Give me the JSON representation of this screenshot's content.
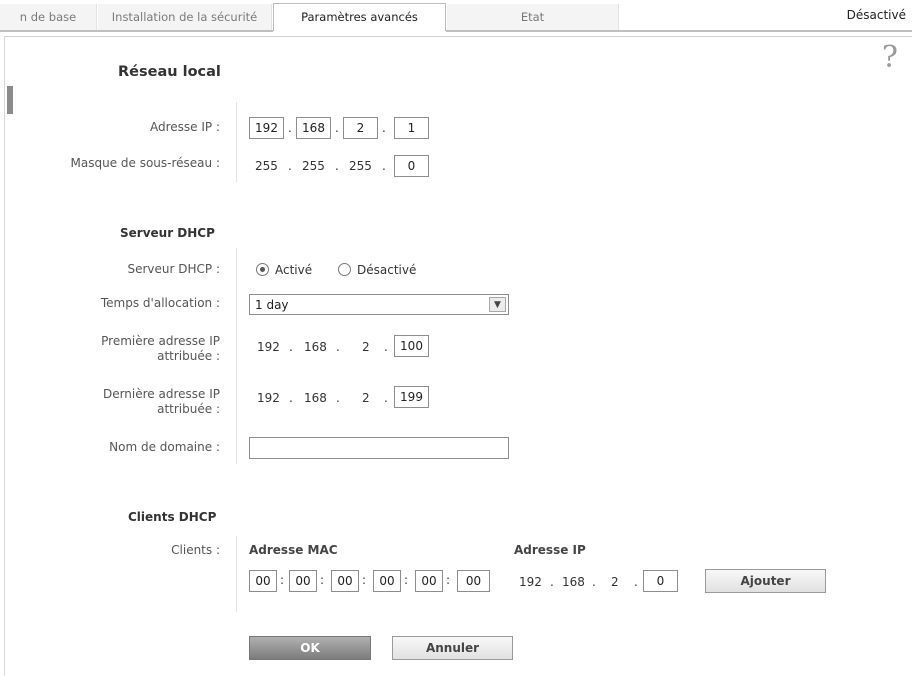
{
  "tabs": [
    {
      "label": "n de base"
    },
    {
      "label": "Installation de la sécurité"
    },
    {
      "label": "Paramètres avancés"
    },
    {
      "label": "Etat"
    }
  ],
  "status_text": "Désactivé",
  "help_glyph": "?",
  "lan": {
    "title": "Réseau local",
    "ip_label": "Adresse IP :",
    "ip": [
      "192",
      "168",
      "2",
      "1"
    ],
    "mask_label": "Masque de sous-réseau :",
    "mask": [
      "255",
      "255",
      "255",
      "0"
    ]
  },
  "dhcp": {
    "title": "Serveur DHCP",
    "server_label": "Serveur DHCP :",
    "option_on": "Activé",
    "option_off": "Désactivé",
    "lease_label": "Temps d'allocation :",
    "lease_value": "1 day",
    "first_label_1": "Première adresse IP",
    "first_label_2": "attribuée :",
    "first_ip": [
      "192",
      "168",
      "2",
      "100"
    ],
    "last_label_1": "Dernière adresse IP",
    "last_label_2": "attribuée :",
    "last_ip": [
      "192",
      "168",
      "2",
      "199"
    ],
    "domain_label": "Nom de domaine :",
    "domain_value": ""
  },
  "clients": {
    "title": "Clients DHCP",
    "label": "Clients :",
    "mac_header": "Adresse MAC",
    "ip_header": "Adresse IP",
    "mac": [
      "00",
      "00",
      "00",
      "00",
      "00",
      "00"
    ],
    "ip": [
      "192",
      "168",
      "2",
      "0"
    ],
    "add_button": "Ajouter"
  },
  "buttons": {
    "ok": "OK",
    "cancel": "Annuler"
  },
  "colors": {
    "accent_ok": "#8c8c8c",
    "tab_active_bg": "#ffffff"
  }
}
